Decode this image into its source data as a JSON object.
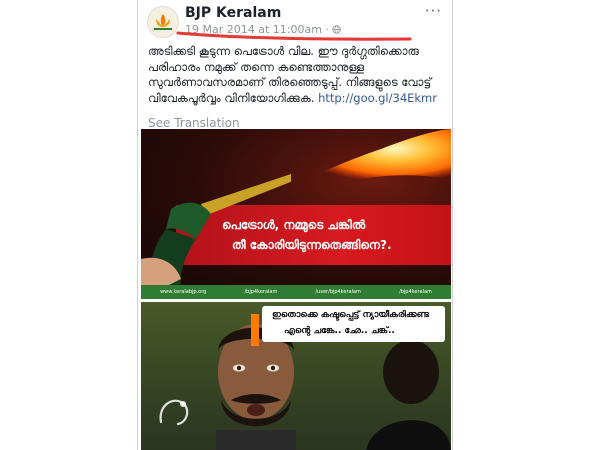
{
  "post": {
    "page_name": "BJP Keralam",
    "timestamp": "19 Mar 2014 at 11:00am",
    "privacy_icon": "globe-icon",
    "menu_icon": "more-options-icon",
    "menu_glyph": "···",
    "text_body": "അടിക്കടി കൂടുന്ന പെട്രോൾ വില. ഈ ദുർഗ്ഗതിക്കൊരു പരിഹാരം നമുക്ക് തന്നെ കണ്ടെത്താനുള്ള സുവർണാവസരമാണ് തിരഞ്ഞെടുപ്പ്. നിങ്ങളുടെ വോട്ട് വിവേകപൂർവ്വം വിനിയോഗിക്കുക.",
    "link": "http://goo.gl/34Ekmr",
    "see_translation": "See Translation",
    "separator": "·"
  },
  "ad_image": {
    "headline_line1": "പെട്രോൾ, നമ്മുടെ ചങ്കിൽ",
    "headline_line2": "തീ കോരിയിടുന്നതെങ്ങിനെ?.",
    "footer": [
      "www.keralabjp.org",
      "/bjp4keralam",
      "/user/bjp4keralam",
      "/bjp4keralam"
    ]
  },
  "meme_image": {
    "caption_line1": "ഇതൊക്കെ കഷ്ടപ്പെട്ട് ന്യായീകരിക്കണ്ട",
    "caption_line2": "എന്റെ ചങ്കേ.. ഛേ.. ചങ്ക്.."
  },
  "colors": {
    "link": "#365899",
    "underline_mark": "#e53935",
    "banner_red": "#d61a1f",
    "footer_green": "#2e7d32"
  }
}
